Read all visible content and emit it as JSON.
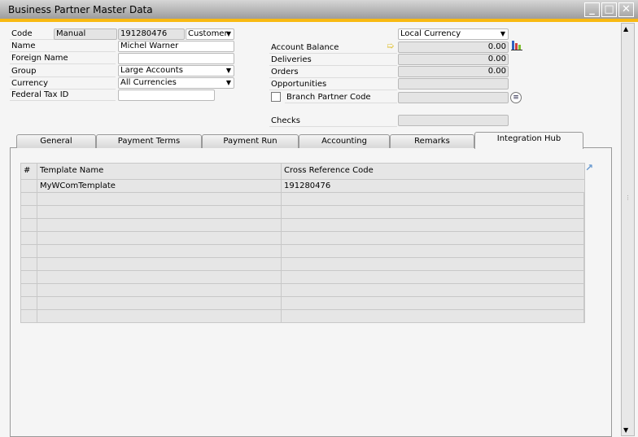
{
  "window": {
    "title": "Business Partner Master Data",
    "minimize": "_",
    "maximize": "□",
    "close": "✕"
  },
  "form": {
    "code_label": "Code",
    "code_series": "Manual",
    "code_value": "191280476",
    "type": "Customer",
    "name_label": "Name",
    "name_value": "Michel Warner",
    "foreign_name_label": "Foreign Name",
    "foreign_name_value": "",
    "group_label": "Group",
    "group_value": "Large Accounts",
    "currency_label": "Currency",
    "currency_value": "All Currencies",
    "federal_tax_label": "Federal Tax ID",
    "federal_tax_value": ""
  },
  "balances": {
    "currency_select": "Local Currency",
    "account_balance_label": "Account Balance",
    "account_balance": "0.00",
    "deliveries_label": "Deliveries",
    "deliveries": "0.00",
    "orders_label": "Orders",
    "orders": "0.00",
    "opportunities_label": "Opportunities",
    "opportunities": "",
    "branch_label": "Branch Partner Code",
    "branch_value": "",
    "checks_label": "Checks",
    "checks": ""
  },
  "tabs": [
    {
      "label": "General"
    },
    {
      "label": "Payment Terms"
    },
    {
      "label": "Payment Run"
    },
    {
      "label": "Accounting"
    },
    {
      "label": "Remarks"
    },
    {
      "label": "Integration Hub"
    }
  ],
  "grid": {
    "headers": [
      "#",
      "Template Name",
      "Cross Reference Code"
    ],
    "rows": [
      {
        "num": "",
        "template": "MyWComTemplate",
        "code": "191280476"
      }
    ]
  }
}
